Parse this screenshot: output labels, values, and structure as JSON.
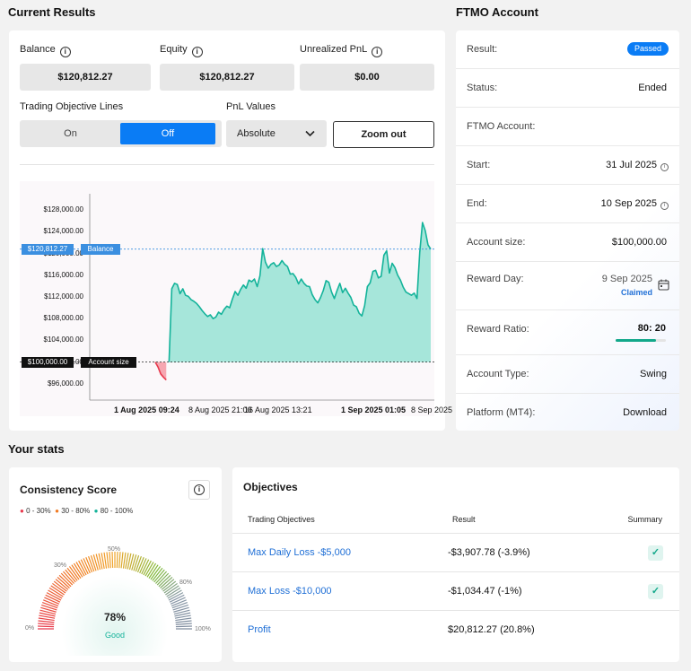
{
  "current_results": {
    "title": "Current Results",
    "balance_label": "Balance",
    "balance_value": "$120,812.27",
    "equity_label": "Equity",
    "equity_value": "$120,812.27",
    "unrealized_label": "Unrealized PnL",
    "unrealized_value": "$0.00",
    "objective_lines_label": "Trading Objective Lines",
    "toggle_on": "On",
    "toggle_off": "Off",
    "pnl_label": "PnL Values",
    "pnl_selected": "Absolute",
    "zoom_out": "Zoom out"
  },
  "chart_data": {
    "type": "area",
    "y_ticks": [
      "$128,000.00",
      "$124,000.00",
      "$120,000.00",
      "$116,000.00",
      "$112,000.00",
      "$108,000.00",
      "$104,000.00",
      "$100,000.00",
      "$96,000.00"
    ],
    "ylim": [
      93000,
      131000
    ],
    "x_ticks": [
      "1 Aug 2025 09:24",
      "8 Aug 2025 21:00",
      "16 Aug 2025 13:21",
      "1 Sep 2025 01:05",
      "8 Sep 2025"
    ],
    "balance_marker": {
      "value": 120812.27,
      "label": "$120,812.27",
      "tag": "Balance"
    },
    "account_size_marker": {
      "value": 100000,
      "label": "$100,000.00",
      "tag": "Account size"
    },
    "series": [
      {
        "values": [
          100000,
          99100,
          97800,
          97200,
          96700,
          100000,
          113500,
          114500,
          114300,
          112600,
          113500,
          112300,
          112100,
          111500,
          111200,
          110800,
          110200,
          109500,
          108900,
          108400,
          108700,
          108000,
          108300,
          109200,
          108800,
          109700,
          110300,
          110000,
          111600,
          113000,
          112300,
          113400,
          114200,
          113600,
          115100,
          114800,
          115300,
          113900,
          115900,
          120900,
          118400,
          117300,
          118000,
          118300,
          117600,
          117900,
          118700,
          118000,
          117600,
          116200,
          116300,
          115600,
          114400,
          115300,
          114500,
          114000,
          113900,
          112400,
          111500,
          110900,
          111900,
          113200,
          115000,
          114700,
          112900,
          111700,
          113200,
          114500,
          112800,
          113600,
          112700,
          111900,
          110500,
          110200,
          109000,
          108500,
          110400,
          113900,
          114600,
          116700,
          116900,
          115500,
          115800,
          119700,
          120500,
          116400,
          118200,
          117400,
          116000,
          115100,
          113800,
          112900,
          112600,
          112300,
          112700,
          111700,
          120200,
          125700,
          124200,
          121600,
          120800
        ]
      }
    ],
    "colors": {
      "line": "#14b39a",
      "fill": "#a6e6da",
      "loss": "#e8394d",
      "loss_fill": "#f6a7b1",
      "balance_line": "#3b8fe0"
    }
  },
  "ftmo_account": {
    "title": "FTMO Account",
    "rows": [
      {
        "label": "Result:",
        "value": "Passed"
      },
      {
        "label": "Status:",
        "value": "Ended"
      },
      {
        "label": "FTMO Account:",
        "value": ""
      },
      {
        "label": "Start:",
        "value": "31 Jul 2025"
      },
      {
        "label": "End:",
        "value": "10 Sep 2025"
      },
      {
        "label": "Account size:",
        "value": "$100,000.00"
      },
      {
        "label": "Reward Day:",
        "value": "9 Sep 2025",
        "sub": "Claimed"
      },
      {
        "label": "Reward Ratio:",
        "value": "80: 20",
        "progress": 0.8
      },
      {
        "label": "Account Type:",
        "value": "Swing"
      },
      {
        "label": "Platform (MT4):",
        "value": "Download"
      }
    ]
  },
  "stats": {
    "title": "Your stats",
    "consistency": {
      "title": "Consistency Score",
      "legend": [
        "0 - 30%",
        "30 - 80%",
        "80 - 100%"
      ],
      "legend_colors": [
        "#e8394d",
        "#f07a22",
        "#14b39a"
      ],
      "gauge_labels": [
        "0%",
        "30%",
        "50%",
        "80%",
        "100%"
      ],
      "score": "78%",
      "score_value": 78,
      "rating": "Good"
    },
    "objectives": {
      "title": "Objectives",
      "col_objective": "Trading Objectives",
      "col_result": "Result",
      "col_summary": "Summary",
      "rows": [
        {
          "name": "Max Daily Loss -$5,000",
          "result": "-$3,907.78 (-3.9%)",
          "passed": true
        },
        {
          "name": "Max Loss -$10,000",
          "result": "-$1,034.47 (-1%)",
          "passed": true
        },
        {
          "name": "Profit",
          "result": "$20,812.27 (20.8%)",
          "passed": false
        }
      ]
    }
  }
}
